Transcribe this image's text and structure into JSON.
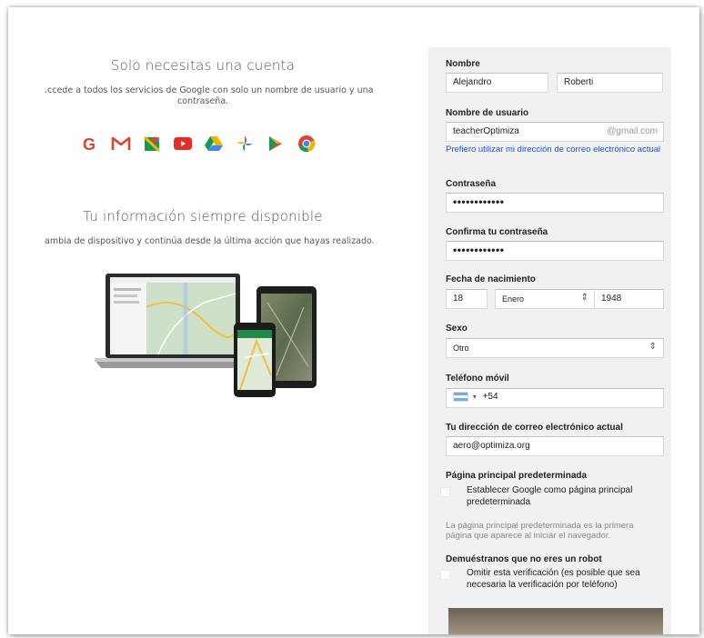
{
  "intro": {
    "heading1": "Solo necesitas una cuenta",
    "sub1_line1": ".ccede a todos los servicios de Google con solo un nombre de usuario y una",
    "sub1_line2": "contraseña.",
    "apps": [
      "G",
      "M",
      "maps",
      "youtube",
      "drive",
      "photos",
      "play",
      "chrome"
    ],
    "heading2": "Tu información siempre disponible",
    "sub2": "ambia de dispositivo y continúa desde la última acción que hayas realizado."
  },
  "form": {
    "name_label": "Nombre",
    "first_name": "Alejandro",
    "last_name": "Roberti",
    "username_label": "Nombre de usuario",
    "username": "teacherOptimiza",
    "username_suffix": "@gmail.com",
    "use_current_email_link": "Prefiero utilizar mi dirección de correo electrónico actual",
    "password_label": "Contraseña",
    "password": "••••••••••••",
    "confirm_label": "Confirma tu contraseña",
    "confirm_password": "••••••••••••",
    "birth_label": "Fecha de nacimiento",
    "birth_day": "18",
    "birth_month": "Enero",
    "birth_year": "1948",
    "gender_label": "Sexo",
    "gender": "Otro",
    "phone_label": "Teléfono móvil",
    "phone_prefix": "+54",
    "current_email_label": "Tu dirección de correo electrónico actual",
    "current_email": "aero@optimiza.org",
    "homepage_label": "Página principal predeterminada",
    "homepage_checkbox": "Establecer Google como página principal predeterminada",
    "homepage_hint": "La página principal predeterminada es la primera página que aparece al iniciar el navegador.",
    "robot_label": "Demuéstranos que no eres un robot",
    "robot_checkbox": "Omitir esta verificación (es posible que sea necesaria la verificación por teléfono)"
  },
  "colors": {
    "panel_bg": "#f1f1f1",
    "link": "#1a58d4",
    "google_red": "#db4437",
    "google_blue": "#4285f4",
    "google_green": "#0f9d58",
    "google_yellow": "#f4b400"
  }
}
